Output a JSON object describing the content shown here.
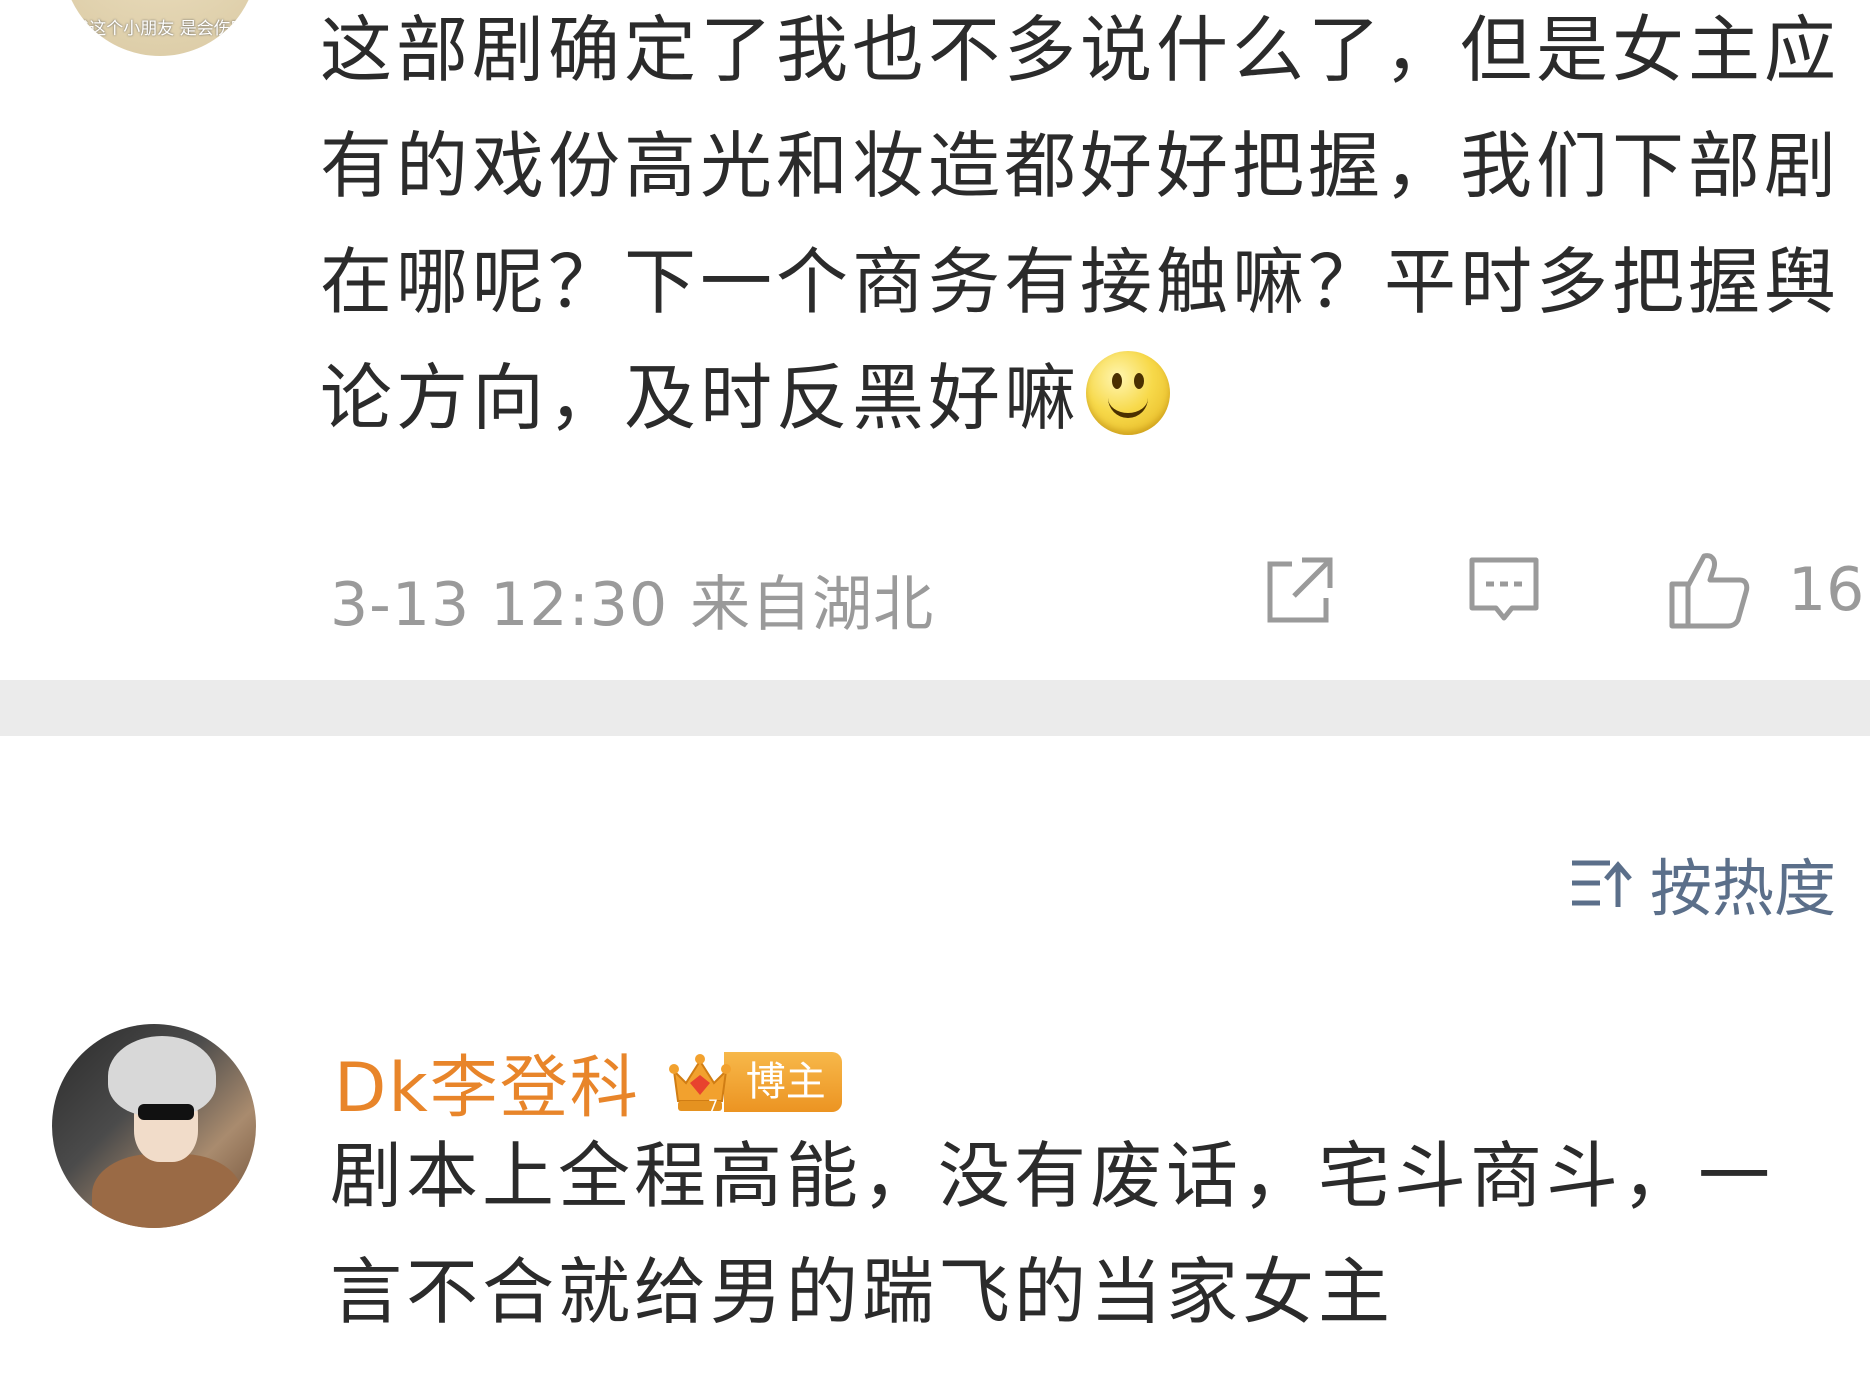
{
  "post": {
    "avatar_caption": "我这个小朋友 是会伤害",
    "body": "这部剧确定了我也不多说什么了，但是女主应有的戏份高光和妆造都好好把握，我们下部剧在哪呢？下一个商务有接触嘛？平时多把握舆论方向，及时反黑好嘛",
    "emoji": "smile-emoji",
    "time": "3-13 12:30",
    "location": "来自湖北",
    "share_icon": "share-icon",
    "comment_icon": "comment-icon",
    "like_icon": "thumbs-up-icon",
    "like_count": "16"
  },
  "sort": {
    "icon": "sort-icon",
    "label": "按热度"
  },
  "comment": {
    "username": "Dk李登科",
    "badge_label": "博主",
    "badge_level": "7",
    "text": "剧本上全程高能，没有废话，宅斗商斗，一言不合就给男的踹飞的当家女主"
  },
  "colors": {
    "username": "#e8852a",
    "sort_text": "#5b6f8a",
    "meta_text": "#9a9a9a",
    "divider": "#ebebeb"
  }
}
